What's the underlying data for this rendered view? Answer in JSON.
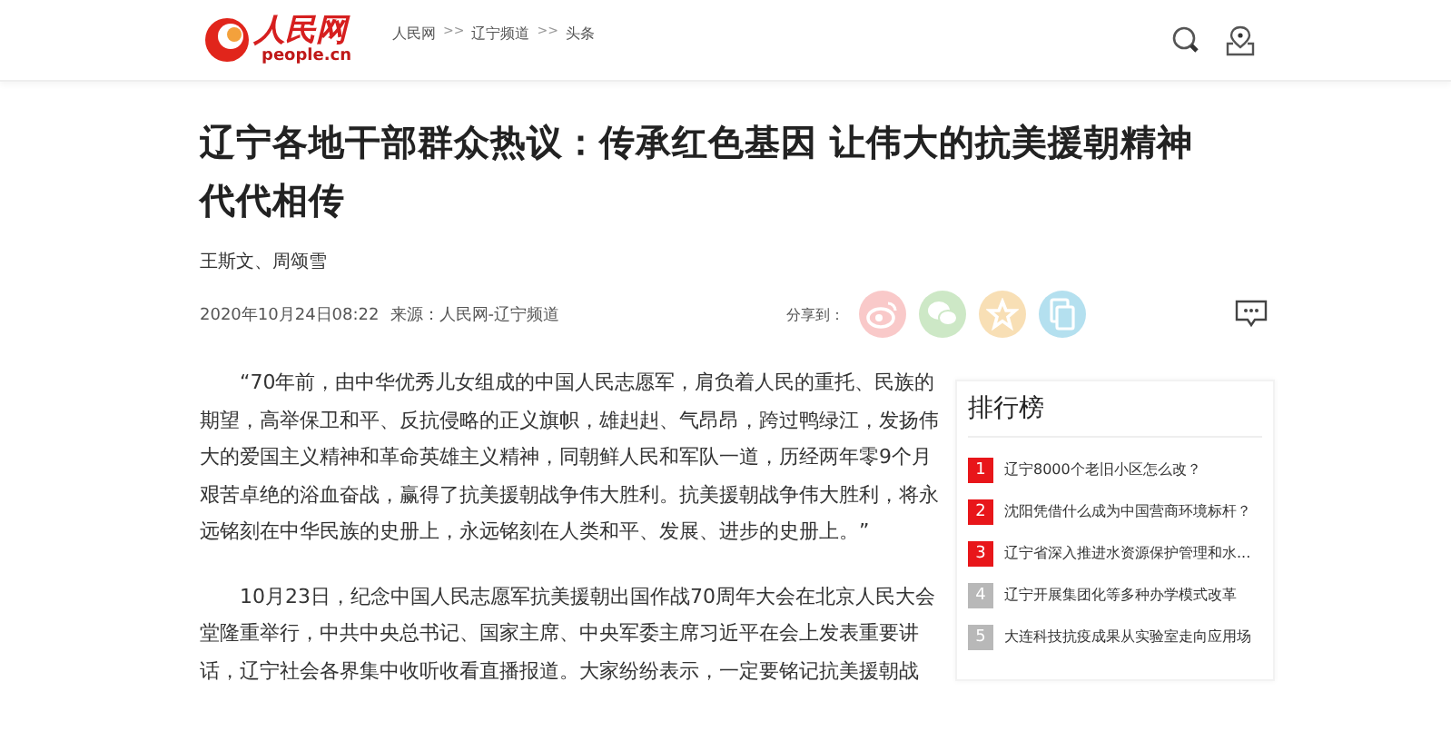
{
  "header": {
    "logo": {
      "name": "人民网",
      "domain": "people.cn"
    },
    "breadcrumb": [
      {
        "text": "人民网",
        "kind": "link"
      },
      {
        "text": ">>",
        "kind": "separator"
      },
      {
        "text": "辽宁频道",
        "kind": "link"
      },
      {
        "text": ">>",
        "kind": "separator"
      },
      {
        "text": "头条",
        "kind": "link"
      }
    ]
  },
  "article": {
    "title": "辽宁各地干部群众热议：传承红色基因 让伟大的抗美援朝精神代代相传",
    "authors": "王斯文、周颂雪",
    "date": "2020年10月24日08:22",
    "source": "来源：人民网-辽宁频道",
    "share_label": "分享到：",
    "share_buttons": [
      {
        "kind": "weibo",
        "color": "#f9c9c9"
      },
      {
        "kind": "wechat",
        "color": "#cde8c6"
      },
      {
        "kind": "favorite",
        "color": "#f8dfb5"
      },
      {
        "kind": "copy",
        "color": "#b4e0ef"
      }
    ],
    "paragraphs": [
      "“70年前，由中华优秀儿女组成的中国人民志愿军，肩负着人民的重托、民族的期望，高举保卫和平、反抗侵略的正义旗帜，雄赳赳、气昂昂，跨过鸭绿江，发扬伟大的爱国主义精神和革命英雄主义精神，同朝鲜人民和军队一道，历经两年零9个月艰苦卓绝的浴血奋战，赢得了抗美援朝战争伟大胜利。抗美援朝战争伟大胜利，将永远铭刻在中华民族的史册上，永远铭刻在人类和平、发展、进步的史册上。”",
      "10月23日，纪念中国人民志愿军抗美援朝出国作战70周年大会在北京人民大会堂隆重举行，中共中央总书记、国家主席、中央军委主席习近平在会上发表重要讲话，辽宁社会各界集中收听收看直播报道。大家纷纷表示，一定要铭记抗美援朝战"
    ]
  },
  "ranking": {
    "title": "排行榜",
    "items": [
      {
        "rank": "1",
        "text": "辽宁8000个老旧小区怎么改？",
        "color": "#e8161a"
      },
      {
        "rank": "2",
        "text": "沈阳凭借什么成为中国营商环境标杆？",
        "color": "#e8161a"
      },
      {
        "rank": "3",
        "text": "辽宁省深入推进水资源保护管理和水...",
        "color": "#e8161a"
      },
      {
        "rank": "4",
        "text": "辽宁开展集团化等多种办学模式改革",
        "color": "#b8b8b8"
      },
      {
        "rank": "5",
        "text": "大连科技抗疫成果从实验室走向应用场",
        "color": "#b8b8b8"
      }
    ]
  }
}
